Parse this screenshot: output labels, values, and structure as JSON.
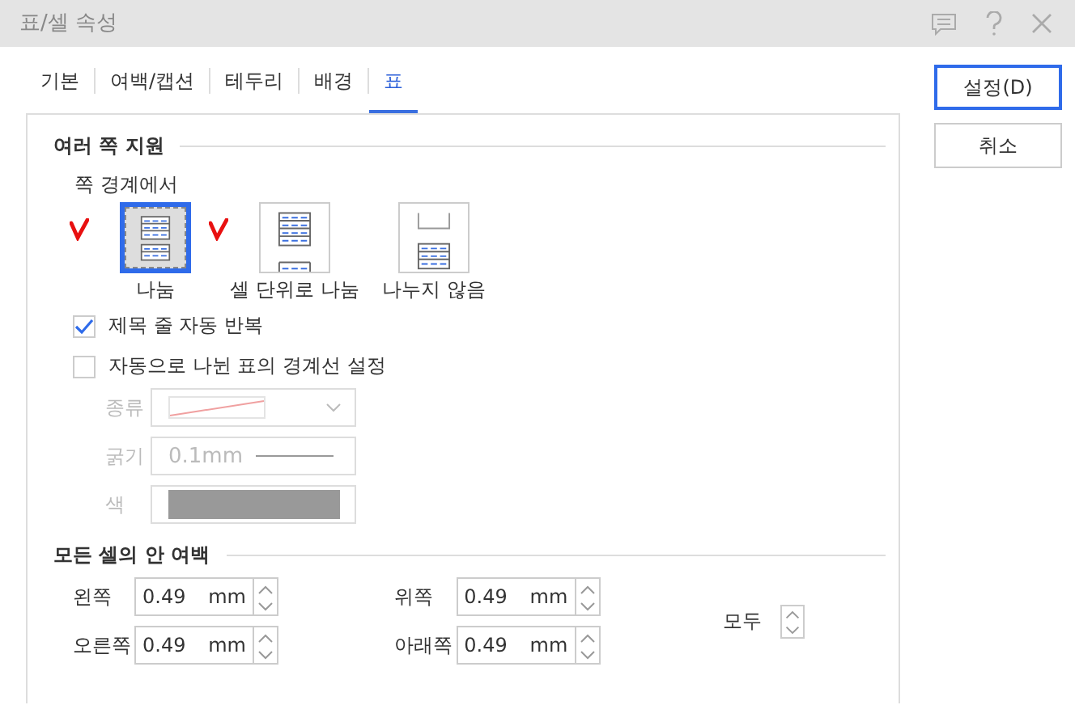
{
  "window": {
    "title": "표/셀 속성"
  },
  "tabs": [
    {
      "label": "기본",
      "selected": false
    },
    {
      "label": "여백/캡션",
      "selected": false
    },
    {
      "label": "테두리",
      "selected": false
    },
    {
      "label": "배경",
      "selected": false
    },
    {
      "label": "표",
      "selected": true
    }
  ],
  "buttons": [
    {
      "label": "설정(D)",
      "kind": "primary"
    },
    {
      "label": "취소",
      "kind": "normal"
    }
  ],
  "multi_page": {
    "heading": "여러 쪽 지원",
    "sub_heading": "쪽 경계에서",
    "split_options": [
      {
        "label": "나눔",
        "kind": "split",
        "selected": true,
        "annotated": true
      },
      {
        "label": "셀 단위로 나눔",
        "kind": "cell-split",
        "selected": false,
        "annotated": true
      },
      {
        "label": "나누지 않음",
        "kind": "no-split",
        "selected": false,
        "annotated": false
      }
    ],
    "checkboxes": [
      {
        "label": "제목 줄 자동 반복",
        "checked": true
      },
      {
        "label": "자동으로 나뉜 표의 경계선 설정",
        "checked": false
      }
    ],
    "border_fields": [
      {
        "label": "종류",
        "kind": "line-type",
        "disabled": true
      },
      {
        "label": "굵기",
        "kind": "thickness",
        "value": "0.1mm",
        "disabled": true
      },
      {
        "label": "색",
        "kind": "color",
        "disabled": true
      }
    ]
  },
  "cell_margins": {
    "heading": "모든 셀의 안 여백",
    "fields": [
      {
        "label": "왼쪽",
        "value": "0.49",
        "unit": "mm"
      },
      {
        "label": "위쪽",
        "value": "0.49",
        "unit": "mm"
      },
      {
        "label": "오른쪽",
        "value": "0.49",
        "unit": "mm"
      },
      {
        "label": "아래쪽",
        "value": "0.49",
        "unit": "mm"
      }
    ],
    "all_label": "모두"
  }
}
